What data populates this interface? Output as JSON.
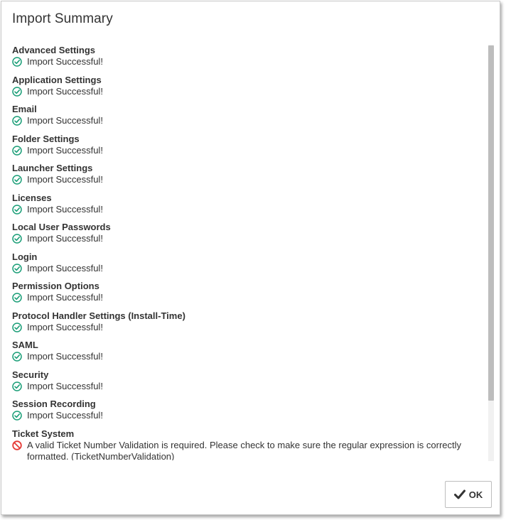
{
  "dialog": {
    "title": "Import Summary",
    "ok_label": "OK"
  },
  "colors": {
    "success": "#1a9e77",
    "error": "#e53935",
    "text": "#333333"
  },
  "items": [
    {
      "name": "Advanced Settings",
      "status": "success",
      "message": "Import Successful!"
    },
    {
      "name": "Application Settings",
      "status": "success",
      "message": "Import Successful!"
    },
    {
      "name": "Email",
      "status": "success",
      "message": "Import Successful!"
    },
    {
      "name": "Folder Settings",
      "status": "success",
      "message": "Import Successful!"
    },
    {
      "name": "Launcher Settings",
      "status": "success",
      "message": "Import Successful!"
    },
    {
      "name": "Licenses",
      "status": "success",
      "message": "Import Successful!"
    },
    {
      "name": "Local User Passwords",
      "status": "success",
      "message": "Import Successful!"
    },
    {
      "name": "Login",
      "status": "success",
      "message": "Import Successful!"
    },
    {
      "name": "Permission Options",
      "status": "success",
      "message": "Import Successful!"
    },
    {
      "name": "Protocol Handler Settings (Install-Time)",
      "status": "success",
      "message": "Import Successful!"
    },
    {
      "name": "SAML",
      "status": "success",
      "message": "Import Successful!"
    },
    {
      "name": "Security",
      "status": "success",
      "message": "Import Successful!"
    },
    {
      "name": "Session Recording",
      "status": "success",
      "message": "Import Successful!"
    },
    {
      "name": "Ticket System",
      "status": "error",
      "message": "A valid Ticket Number Validation is required. Please check to make sure the regular expression is correctly formatted. (TicketNumberValidation)"
    }
  ]
}
